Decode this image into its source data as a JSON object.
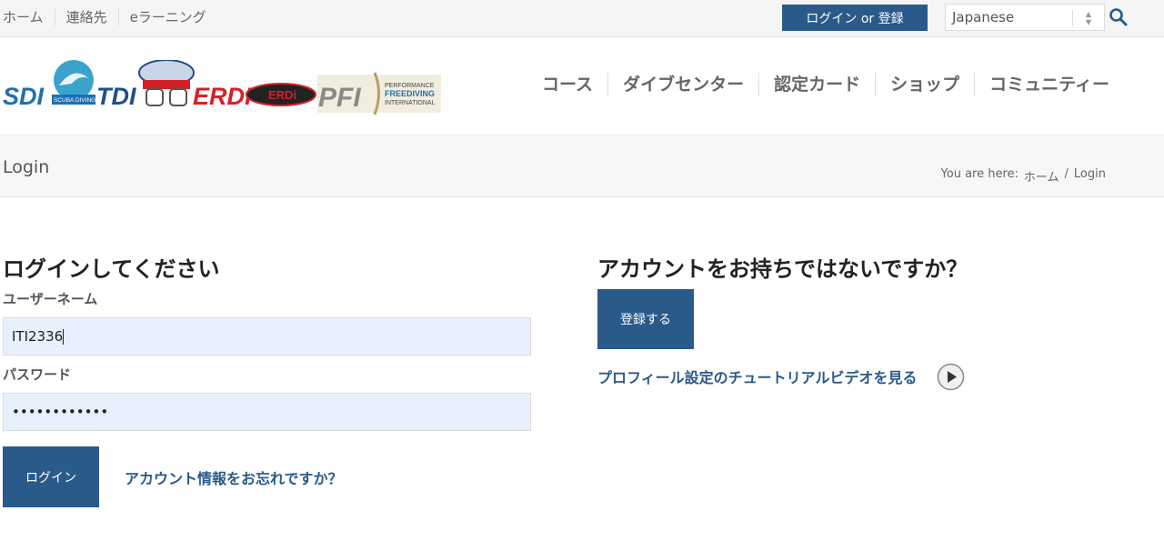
{
  "topbar": {
    "links": [
      "ホーム",
      "連絡先",
      "eラーニング"
    ],
    "login_register_label": "ログイン or 登録",
    "language": "Japanese"
  },
  "logos": {
    "sdi": "SDI",
    "sdi_sub": "SCUBA DIVING INTERNATIONAL",
    "tdi": "TDI",
    "erdi": "ERDI",
    "erdi_badge": "ERDi",
    "pfi": "PFI",
    "pfi_sub": [
      "PERFORMANCE",
      "FREEDIVING",
      "INTERNATIONAL"
    ]
  },
  "nav": {
    "items": [
      "コース",
      "ダイブセンター",
      "認定カード",
      "ショップ",
      "コミュニティー"
    ]
  },
  "band": {
    "page_title": "Login",
    "breadcrumb_prefix": "You are here:",
    "breadcrumb_home": "ホーム",
    "breadcrumb_sep": "/",
    "breadcrumb_current": "Login"
  },
  "login": {
    "heading": "ログインしてください",
    "username_label": "ユーザーネーム",
    "username_value": "ITI2336",
    "password_label": "パスワード",
    "password_value": "••••••••••••",
    "submit_label": "ログイン",
    "forgot_link": "アカウント情報をお忘れですか？"
  },
  "register": {
    "heading": "アカウントをお持ちではないですか？",
    "button_label": "登録する",
    "tutorial_link": "プロフィール設定のチュートリアルビデオを見る"
  },
  "colors": {
    "brand_blue": "#2a5a8a",
    "sdi_blue": "#1f6fb0",
    "erdi_red": "#d62027",
    "pfi_gold": "#b8a060",
    "autofill_bg": "#e8f0fe"
  },
  "icons": {
    "search": "search-icon",
    "play": "play-icon",
    "select_arrows": "select-arrows-icon"
  }
}
